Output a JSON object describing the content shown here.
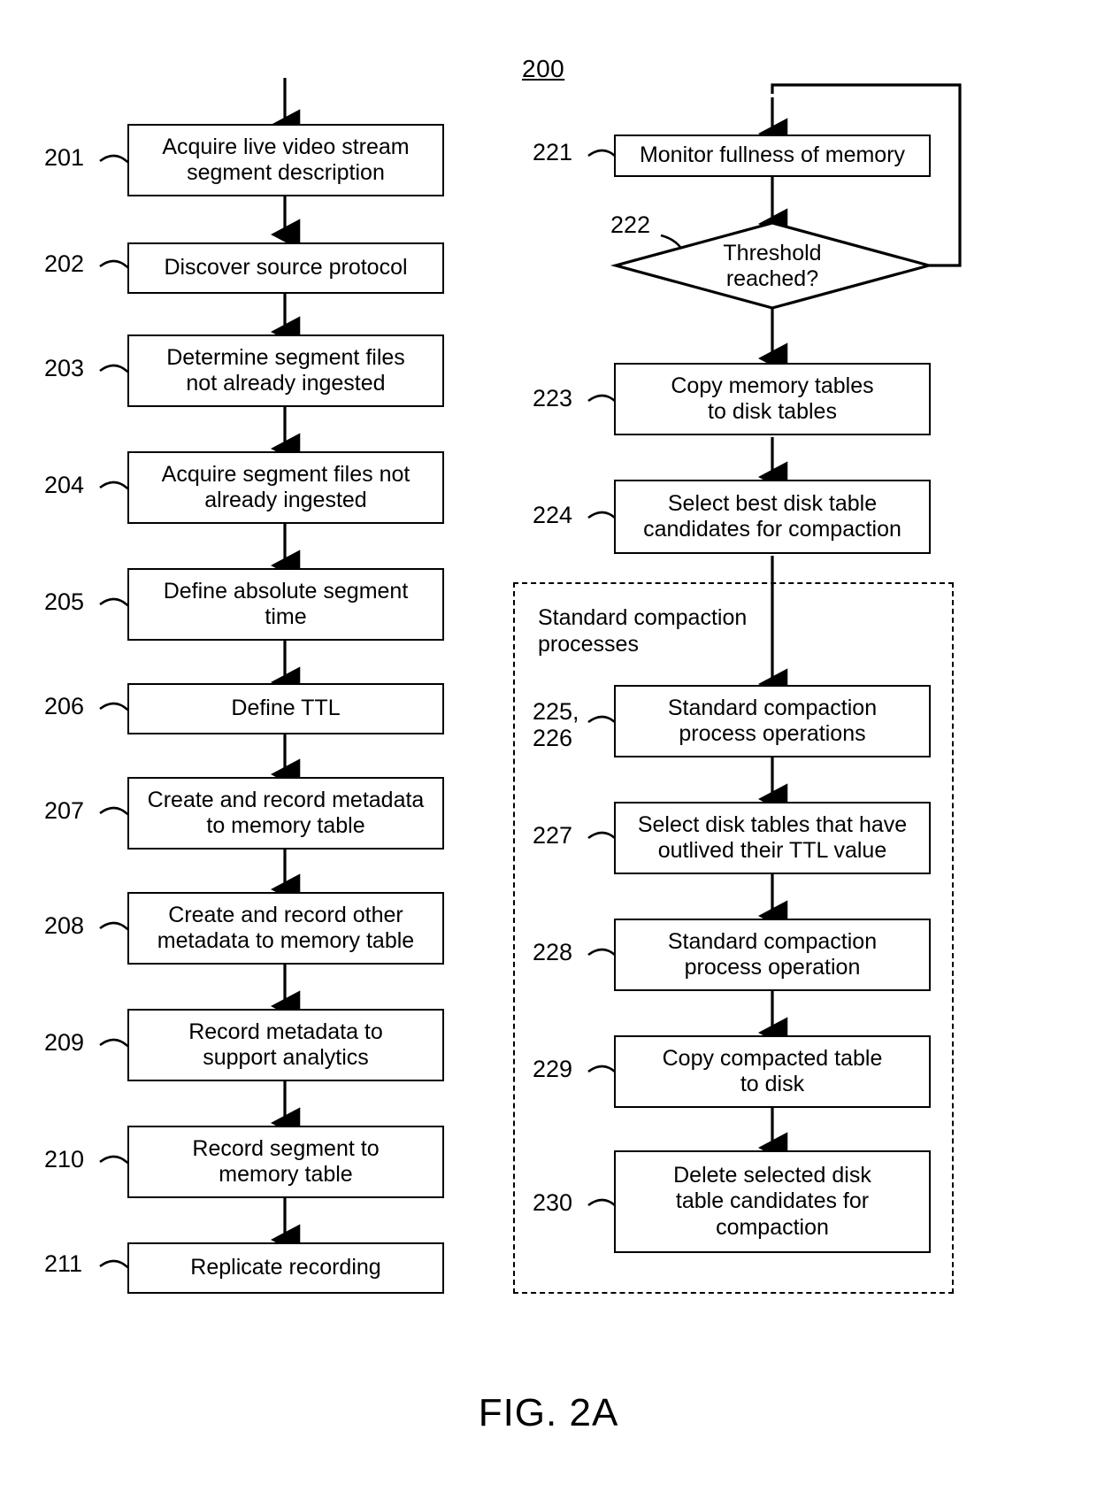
{
  "figure": {
    "caption": "FIG. 2A",
    "diagram_number": "200"
  },
  "left_flow": {
    "steps": [
      {
        "ref": "201",
        "label": "Acquire live video stream\nsegment description"
      },
      {
        "ref": "202",
        "label": "Discover source protocol"
      },
      {
        "ref": "203",
        "label": "Determine segment files\nnot already ingested"
      },
      {
        "ref": "204",
        "label": "Acquire segment files not\nalready ingested"
      },
      {
        "ref": "205",
        "label": "Define absolute segment\ntime"
      },
      {
        "ref": "206",
        "label": "Define TTL"
      },
      {
        "ref": "207",
        "label": "Create and record metadata\nto memory table"
      },
      {
        "ref": "208",
        "label": "Create and record other\nmetadata to memory table"
      },
      {
        "ref": "209",
        "label": "Record metadata to\nsupport analytics"
      },
      {
        "ref": "210",
        "label": "Record segment to\nmemory table"
      },
      {
        "ref": "211",
        "label": "Replicate recording"
      }
    ]
  },
  "right_flow": {
    "steps": [
      {
        "ref": "221",
        "label": "Monitor fullness of memory",
        "shape": "process"
      },
      {
        "ref": "222",
        "label": "Threshold\nreached?",
        "shape": "decision"
      },
      {
        "ref": "223",
        "label": "Copy memory tables\nto disk tables",
        "shape": "process"
      },
      {
        "ref": "224",
        "label": "Select best disk table\ncandidates for compaction",
        "shape": "process"
      }
    ],
    "group": {
      "label": "Standard compaction\nprocesses",
      "steps": [
        {
          "ref": "225,\n226",
          "label": "Standard compaction\nprocess operations"
        },
        {
          "ref": "227",
          "label": "Select disk tables that have\noutlived their TTL value"
        },
        {
          "ref": "228",
          "label": "Standard compaction\nprocess operation"
        },
        {
          "ref": "229",
          "label": "Copy compacted table\nto disk"
        },
        {
          "ref": "230",
          "label": "Delete selected disk\ntable candidates for\ncompaction"
        }
      ]
    }
  },
  "colors": {
    "stroke": "#000000",
    "fill": "#ffffff"
  }
}
